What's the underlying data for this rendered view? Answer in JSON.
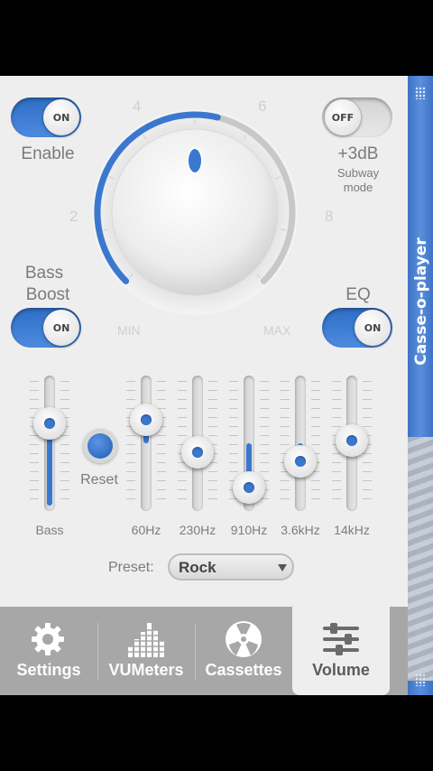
{
  "app": {
    "title": "Casse-o-player"
  },
  "enable": {
    "label": "Enable",
    "state": "ON"
  },
  "subway": {
    "state": "OFF",
    "title": "+3dB",
    "subtitle_line1": "Subway",
    "subtitle_line2": "mode"
  },
  "bass_boost": {
    "label_line1": "Bass",
    "label_line2": "Boost",
    "state": "ON"
  },
  "eq": {
    "label": "EQ",
    "state": "ON"
  },
  "dial": {
    "labels": {
      "n2": "2",
      "n4": "4",
      "n6": "6",
      "n8": "8",
      "min": "MIN",
      "max": "MAX"
    },
    "value_fraction": 0.55
  },
  "sliders": {
    "bass": {
      "label": "Bass",
      "level": 0.75
    },
    "reset_label": "Reset",
    "bands": [
      {
        "label": "60Hz",
        "level": 0.78
      },
      {
        "label": "230Hz",
        "level": 0.5
      },
      {
        "label": "910Hz",
        "level": 0.2
      },
      {
        "label": "3.6kHz",
        "level": 0.42
      },
      {
        "label": "14kHz",
        "level": 0.6
      }
    ]
  },
  "preset": {
    "label": "Preset:",
    "value": "Rock"
  },
  "tabs": [
    {
      "label": "Settings",
      "icon": "gear-icon",
      "active": false
    },
    {
      "label": "VUMeters",
      "icon": "vu-bars-icon",
      "active": false
    },
    {
      "label": "Cassettes",
      "icon": "cassette-reel-icon",
      "active": false
    },
    {
      "label": "Volume",
      "icon": "sliders-icon",
      "active": true
    }
  ],
  "colors": {
    "accent": "#3a78d0",
    "panel": "#eeeeee",
    "tabbar": "#a7a7a7"
  }
}
